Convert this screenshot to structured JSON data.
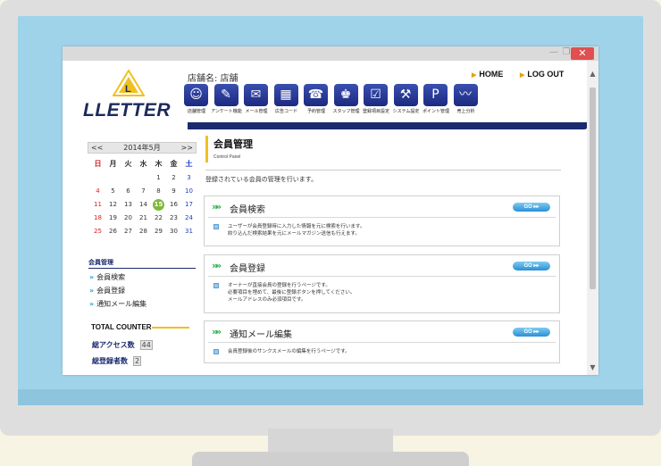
{
  "window": {
    "min_icon": "—",
    "max_icon": "❐",
    "close_icon": "✕"
  },
  "header": {
    "shop_label": "店舗名:  店舗",
    "logo_text": "LLETTER",
    "links": {
      "home": "HOME",
      "logout": "LOG OUT"
    }
  },
  "nav": {
    "items": [
      {
        "label": "店舗管理",
        "icon": "people-icon",
        "glyph": "☺"
      },
      {
        "label": "アンケート機能",
        "icon": "pen-icon",
        "glyph": "✎"
      },
      {
        "label": "メール管理",
        "icon": "mail-icon",
        "glyph": "✉"
      },
      {
        "label": "広告コード",
        "icon": "qr-icon",
        "glyph": "▦"
      },
      {
        "label": "予約管理",
        "icon": "phone-icon",
        "glyph": "☎"
      },
      {
        "label": "スタッフ管理",
        "icon": "staff-icon",
        "glyph": "♚"
      },
      {
        "label": "登録項目設定",
        "icon": "checkbox-icon",
        "glyph": "☑"
      },
      {
        "label": "システム設定",
        "icon": "wrench-icon",
        "glyph": "⚒"
      },
      {
        "label": "ポイント管理",
        "icon": "point-icon",
        "glyph": "P"
      },
      {
        "label": "売上分析",
        "icon": "chart-icon",
        "glyph": "〰"
      }
    ]
  },
  "calendar": {
    "prev": "<<",
    "next": ">>",
    "month_label": "2014年5月",
    "weekdays": [
      "日",
      "月",
      "火",
      "水",
      "木",
      "金",
      "土"
    ],
    "weeks": [
      [
        "",
        "",
        "",
        "",
        "1",
        "2",
        "3"
      ],
      [
        "4",
        "5",
        "6",
        "7",
        "8",
        "9",
        "10"
      ],
      [
        "11",
        "12",
        "13",
        "14",
        "15",
        "16",
        "17"
      ],
      [
        "18",
        "19",
        "20",
        "21",
        "22",
        "23",
        "24"
      ],
      [
        "25",
        "26",
        "27",
        "28",
        "29",
        "30",
        "31"
      ]
    ],
    "today": "15"
  },
  "sidebar": {
    "section_title": "会員管理",
    "items": [
      {
        "label": "会員検索"
      },
      {
        "label": "会員登録"
      },
      {
        "label": "通知メール編集"
      }
    ],
    "counter": {
      "title": "TOTAL COUNTER",
      "access_label": "総アクセス数",
      "access_value": "44",
      "members_label": "総登録者数",
      "members_value": "2"
    }
  },
  "main": {
    "title": "会員管理",
    "subtitle": "Control Panel",
    "description": "登録されている会員の管理を行います。",
    "go_label": "GO ▸▸",
    "panels": [
      {
        "title": "会員検索",
        "lines": [
          "ユーザーが会員登録時に入力した情報を元に検索を行います。",
          "絞り込んだ検索結果を元にメールマガジン送信も行えます。"
        ]
      },
      {
        "title": "会員登録",
        "lines": [
          "オーナーが直接会員の登録を行うページです。",
          "必要項目を埋めて、最後に登録ボタンを押してください。",
          "メールアドレスのみ必須項目です。"
        ]
      },
      {
        "title": "通知メール編集",
        "lines": [
          "会員登録後のサンクスメールの編集を行うページです。"
        ]
      }
    ]
  }
}
